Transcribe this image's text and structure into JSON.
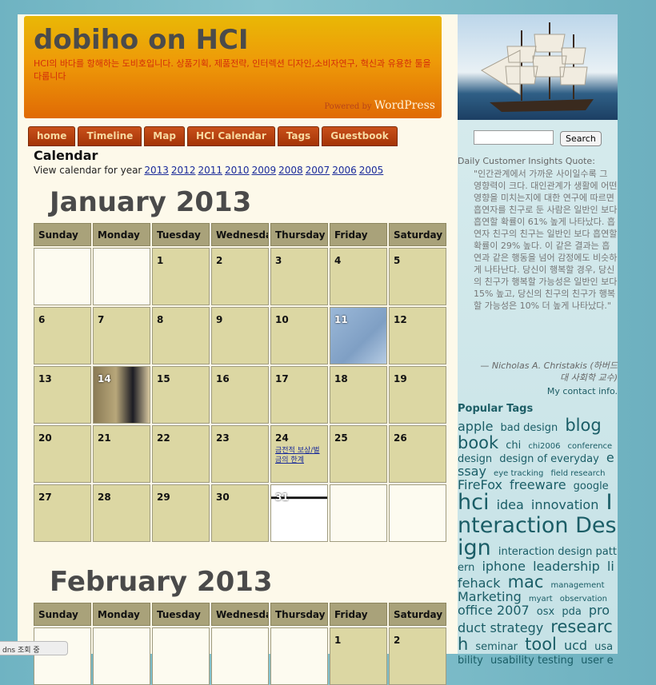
{
  "header": {
    "title": "dobiho on HCI",
    "tagline": "HCI의 바다를 항해하는 도비호입니다. 상품기획, 제품전략, 인터렉션 디자인,소비자연구, 혁신과 유용한 툴을 다룹니다",
    "powered_by": "Powered by",
    "wordpress": "WordPress"
  },
  "nav": [
    "home",
    "Timeline",
    "Map",
    "HCI Calendar",
    "Tags",
    "Guestbook"
  ],
  "page": {
    "title": "Calendar",
    "years_label": "View calendar for year",
    "years": [
      "2013",
      "2012",
      "2011",
      "2010",
      "2009",
      "2008",
      "2007",
      "2006",
      "2005"
    ]
  },
  "weekdays": [
    "Sunday",
    "Monday",
    "Tuesday",
    "Wednesday",
    "Thursday",
    "Friday",
    "Saturday"
  ],
  "months": [
    {
      "title": "January 2013",
      "cells": [
        {},
        {},
        {
          "day": "1"
        },
        {
          "day": "2"
        },
        {
          "day": "3"
        },
        {
          "day": "4"
        },
        {
          "day": "5"
        },
        {
          "day": "6"
        },
        {
          "day": "7"
        },
        {
          "day": "8"
        },
        {
          "day": "9"
        },
        {
          "day": "10"
        },
        {
          "day": "11",
          "image": "sketch"
        },
        {
          "day": "12"
        },
        {
          "day": "13"
        },
        {
          "day": "14",
          "image": "photo"
        },
        {
          "day": "15"
        },
        {
          "day": "16"
        },
        {
          "day": "17"
        },
        {
          "day": "18"
        },
        {
          "day": "19"
        },
        {
          "day": "20"
        },
        {
          "day": "21"
        },
        {
          "day": "22"
        },
        {
          "day": "23"
        },
        {
          "day": "24",
          "link": "금전적 보상/벌금의 한계"
        },
        {
          "day": "25"
        },
        {
          "day": "26"
        },
        {
          "day": "27"
        },
        {
          "day": "28"
        },
        {
          "day": "29"
        },
        {
          "day": "30"
        },
        {
          "day": "31",
          "image": "diagram"
        },
        {},
        {}
      ]
    },
    {
      "title": "February 2013",
      "cells": [
        {},
        {},
        {},
        {},
        {},
        {
          "day": "1"
        },
        {
          "day": "2"
        }
      ]
    }
  ],
  "sidebar": {
    "search_button": "Search",
    "quote_label": "Daily Customer Insights Quote:",
    "quote": "\"인간관계에서 가까운 사이일수록 그 영향력이 크다. 대인관계가 생활에 어떤 영향을 미치는지에 대한 연구에 따르면 흡연자를 친구로 둔 사람은 일반인 보다 흡연할 확률이 61% 높게 나타났다. 흡연자 친구의 친구는 일반인 보다 흡연할 확률이 29% 높다. 이 같은 결과는 흡연과 같은 행동을 넘어 감정에도 비슷하게 나타난다. 당신이 행복할 경우, 당신의 친구가 행복할 가능성은 일반인 보다 15% 높고, 당신의 친구의 친구가 행복할 가능성은 10% 더 높게 나타났다.\"",
    "quote_author": "— Nicholas A. Christakis (하버드대 사회학 교수)",
    "contact": "My contact info.",
    "tags_title": "Popular Tags",
    "tags": [
      {
        "t": "apple",
        "w": 3
      },
      {
        "t": "bad design",
        "w": 2
      },
      {
        "t": "blog",
        "w": 4
      },
      {
        "t": "book",
        "w": 4
      },
      {
        "t": "chi",
        "w": 2
      },
      {
        "t": "chi2006",
        "w": 1
      },
      {
        "t": "conference",
        "w": 1
      },
      {
        "t": "design",
        "w": 2
      },
      {
        "t": "design of everyday",
        "w": 2
      },
      {
        "t": "essay",
        "w": 3
      },
      {
        "t": "eye tracking",
        "w": 1
      },
      {
        "t": "field research",
        "w": 1
      },
      {
        "t": "FireFox",
        "w": 3
      },
      {
        "t": "freeware",
        "w": 3
      },
      {
        "t": "google",
        "w": 2
      },
      {
        "t": "hci",
        "w": 5
      },
      {
        "t": "idea",
        "w": 3
      },
      {
        "t": "innovation",
        "w": 3
      },
      {
        "t": "Interaction Design",
        "w": 5
      },
      {
        "t": "interaction design pattern",
        "w": 2
      },
      {
        "t": "iphone",
        "w": 3
      },
      {
        "t": "leadership",
        "w": 3
      },
      {
        "t": "lifehack",
        "w": 3
      },
      {
        "t": "mac",
        "w": 4
      },
      {
        "t": "management",
        "w": 1
      },
      {
        "t": "Marketing",
        "w": 3
      },
      {
        "t": "myart",
        "w": 1
      },
      {
        "t": "observation",
        "w": 1
      },
      {
        "t": "office 2007",
        "w": 3
      },
      {
        "t": "osx",
        "w": 2
      },
      {
        "t": "pda",
        "w": 2
      },
      {
        "t": "product strategy",
        "w": 3
      },
      {
        "t": "research",
        "w": 4
      },
      {
        "t": "seminar",
        "w": 2
      },
      {
        "t": "tool",
        "w": 4
      },
      {
        "t": "ucd",
        "w": 3
      },
      {
        "t": "usability",
        "w": 2
      },
      {
        "t": "usability testing",
        "w": 2
      },
      {
        "t": "user e",
        "w": 2
      }
    ]
  },
  "status": "dns 조회 중"
}
